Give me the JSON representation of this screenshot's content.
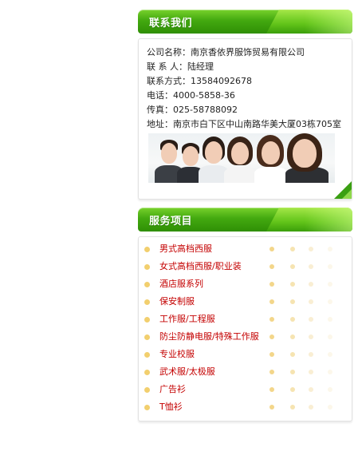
{
  "contact": {
    "title": "联系我们",
    "lines": [
      {
        "label": "公司名称：",
        "value": "南京香依界服饰贸易有限公司"
      },
      {
        "label": "联 系 人：",
        "value": "陆经理"
      },
      {
        "label": "联系方式：",
        "value": "13584092678"
      },
      {
        "label": "电话：",
        "value": "4000-5858-36"
      },
      {
        "label": "传真：",
        "value": "025-58788092"
      },
      {
        "label": "地址：",
        "value": "南京市白下区中山南路华美大厦03栋705室"
      }
    ]
  },
  "services": {
    "title": "服务项目",
    "items": [
      "男式高档西服",
      "女式高档西服/职业装",
      "酒店服系列",
      "保安制服",
      "工作服/工程服",
      "防尘防静电服/特殊工作服",
      "专业校服",
      "武术服/太极服",
      "广告衫",
      "T恤衫"
    ]
  },
  "colors": {
    "header_green": "#43a910",
    "link_red": "#c40000",
    "bullet_yellow": "#f2cf6e"
  }
}
